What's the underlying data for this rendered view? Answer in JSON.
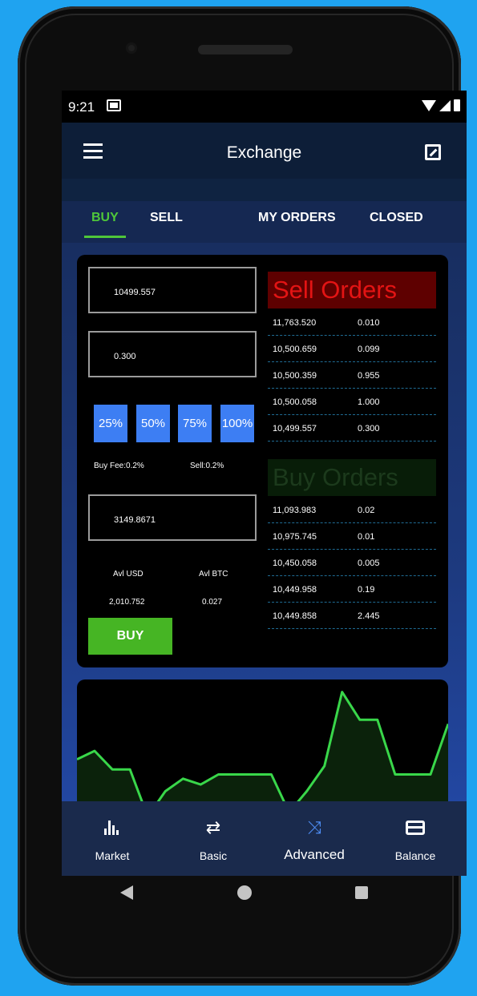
{
  "status_bar": {
    "time": "9:21"
  },
  "app_bar": {
    "title": "Exchange"
  },
  "tabs": [
    {
      "label": "BUY",
      "active": true
    },
    {
      "label": "SELL"
    },
    {
      "label": "MY ORDERS"
    },
    {
      "label": "CLOSED"
    }
  ],
  "order_form": {
    "price_value": "10499.557",
    "amount_value": "0.300",
    "percent_buttons": [
      "25%",
      "50%",
      "75%",
      "100%"
    ],
    "buy_fee": "Buy Fee:0.2%",
    "sell_fee": "Sell:0.2%",
    "total_value": "3149.8671",
    "avl_usd_label": "Avl USD",
    "avl_btc_label": "Avl BTC",
    "avl_usd_value": "2,010.752",
    "avl_btc_value": "0.027",
    "buy_button": "BUY"
  },
  "sell_orders": {
    "title": "Sell Orders",
    "rows": [
      {
        "price": "11,763.520",
        "qty": "0.010"
      },
      {
        "price": "10,500.659",
        "qty": "0.099"
      },
      {
        "price": "10,500.359",
        "qty": "0.955"
      },
      {
        "price": "10,500.058",
        "qty": "1.000"
      },
      {
        "price": "10,499.557",
        "qty": "0.300"
      }
    ]
  },
  "buy_orders": {
    "title": "Buy Orders",
    "rows": [
      {
        "price": "11,093.983",
        "qty": "0.02"
      },
      {
        "price": "10,975.745",
        "qty": "0.01"
      },
      {
        "price": "10,450.058",
        "qty": "0.005"
      },
      {
        "price": "10,449.958",
        "qty": "0.19"
      },
      {
        "price": "10,449.858",
        "qty": "2.445"
      }
    ]
  },
  "price_chart": {
    "line_color": "#39d74a",
    "fill_color": "#0b220b",
    "values": [
      48,
      58,
      36,
      36,
      -20,
      10,
      25,
      18,
      30,
      30,
      30,
      30,
      -15,
      10,
      40,
      128,
      95,
      95,
      30,
      30,
      30,
      90
    ]
  },
  "bottom_nav": [
    {
      "label": "Market",
      "icon": "bar-chart-icon"
    },
    {
      "label": "Basic",
      "icon": "swap-arrows-icon"
    },
    {
      "label": "Advanced",
      "icon": "shuffle-icon",
      "active": true
    },
    {
      "label": "Balance",
      "icon": "credit-card-icon"
    }
  ],
  "colors": {
    "accent_green": "#4fc73a",
    "percent_blue": "#3d7ef3",
    "sell_red": "#e31414",
    "buy_green_title": "#1c3a1c",
    "app_bar": "#0d1e38"
  }
}
